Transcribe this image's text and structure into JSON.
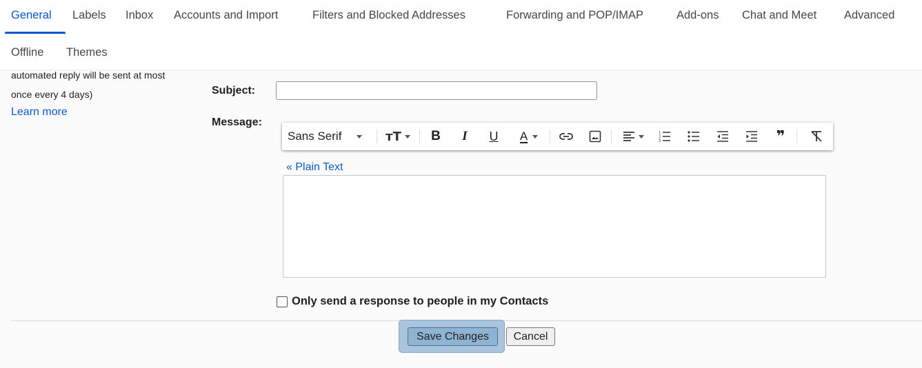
{
  "tabs": {
    "row1": [
      "General",
      "Labels",
      "Inbox",
      "Accounts and Import",
      "Filters and Blocked Addresses",
      "Forwarding and POP/IMAP",
      "Add-ons",
      "Chat and Meet",
      "Advanced"
    ],
    "row2": [
      "Offline",
      "Themes"
    ],
    "active": "General"
  },
  "vacation": {
    "note_line1": "automated reply will be sent at most",
    "note_line2": "once every 4 days)",
    "learn_more": "Learn more",
    "subject_label": "Subject:",
    "subject_value": "",
    "message_label": "Message:",
    "plain_text_link": "« Plain Text",
    "contacts_only_label": "Only send a response to people in my Contacts",
    "contacts_only_checked": false
  },
  "toolbar": {
    "font_family": "Sans Serif",
    "icons": [
      "font-size-icon",
      "bold-icon",
      "italic-icon",
      "underline-icon",
      "text-color-icon",
      "link-icon",
      "image-icon",
      "align-icon",
      "numbered-list-icon",
      "bulleted-list-icon",
      "indent-less-icon",
      "indent-more-icon",
      "quote-icon",
      "remove-formatting-icon"
    ],
    "bold": "B",
    "italic": "I",
    "underline": "U",
    "text_color": "A",
    "font_size": "тT",
    "quote": "❞"
  },
  "actions": {
    "save": "Save Changes",
    "cancel": "Cancel"
  },
  "colors": {
    "accent": "#0b57d0",
    "save_highlight": "#a9c5dd"
  }
}
